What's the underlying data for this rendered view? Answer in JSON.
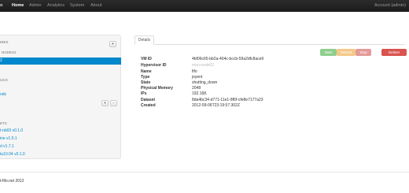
{
  "nav": {
    "brand": "o",
    "items": [
      "Home",
      "Admin",
      "Analytics",
      "System",
      "About"
    ],
    "account": "Account (admin)"
  },
  "sidebar": {
    "section1_header": "IRES",
    "add_label": "+",
    "subheader": "NODES2",
    "selected_item": "2",
    "section2_header": "UGS",
    "link_nodes": "ods",
    "plus_label": "+",
    "minus_label": "-",
    "section3_header": "ETS",
    "packages": [
      "t-nb03 v0.1.0",
      "ine v1.5.1",
      "d v1.7.1",
      "tu10.04 v0.1.0"
    ]
  },
  "main": {
    "tab_label": "Details",
    "details": [
      {
        "key": "VM ID",
        "value": "4bf06c65-bb2a-404c-bccb-59a2dfc8ace9"
      },
      {
        "key": "Hypervisor ID",
        "value": "mon-node02"
      },
      {
        "key": "Name",
        "value": "fifo"
      },
      {
        "key": "Type",
        "value": "joyent"
      },
      {
        "key": "State",
        "value": "shutting_down"
      },
      {
        "key": "Physical Memory",
        "value": "2048"
      },
      {
        "key": "IPs",
        "value": "192.168."
      },
      {
        "key": "Dataset",
        "value": "8da4bc34-d771-11e1-8f6f-cfe8e7177a23"
      },
      {
        "key": "Created",
        "value": "2012-09-06T23:19:57.302Z"
      }
    ],
    "buttons": {
      "start": "Start",
      "reboot": "Reboot",
      "stop": "Stop",
      "delete": "Delete!"
    }
  },
  "footer": {
    "text": "t-fifo.net 2012"
  },
  "colors": {
    "accent": "#0088cc",
    "start": "#8fce8f",
    "reboot": "#f5c98a",
    "stop": "#e39a98",
    "delete": "#d9534f"
  }
}
